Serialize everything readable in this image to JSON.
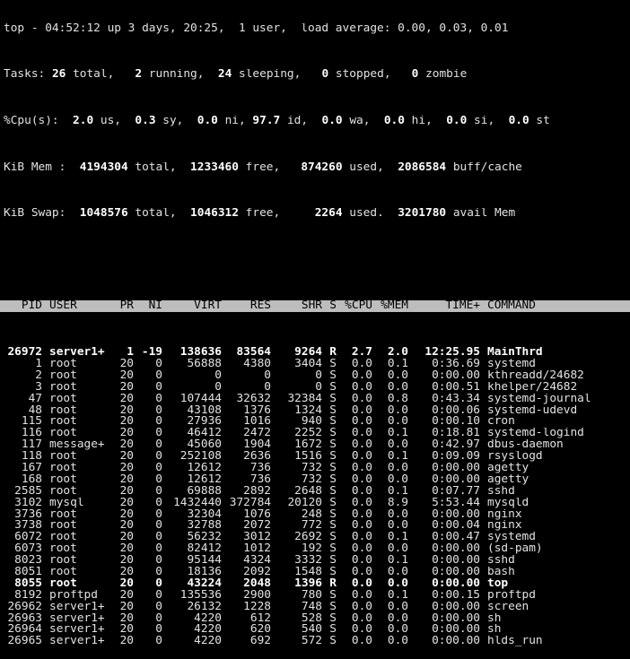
{
  "summary": {
    "top_line": "top - 04:52:12 up 3 days, 20:25,  1 user,  load average: 0.00, 0.03, 0.01",
    "tasks": {
      "label": "Tasks: ",
      "total": "26",
      "total_label": " total,   ",
      "running": "2",
      "running_label": " running,  ",
      "sleeping": "24",
      "sleeping_label": " sleeping,   ",
      "stopped": "0",
      "stopped_label": " stopped,   ",
      "zombie": "0",
      "zombie_label": " zombie"
    },
    "cpu": {
      "label": "%Cpu(s):  ",
      "us": "2.0",
      "us_label": " us,  ",
      "sy": "0.3",
      "sy_label": " sy,  ",
      "ni": "0.0",
      "ni_label": " ni, ",
      "id": "97.7",
      "id_label": " id,  ",
      "wa": "0.0",
      "wa_label": " wa,  ",
      "hi": "0.0",
      "hi_label": " hi,  ",
      "si": "0.0",
      "si_label": " si,  ",
      "st": "0.0",
      "st_label": " st"
    },
    "mem": {
      "label": "KiB Mem :  ",
      "total": "4194304",
      "total_label": " total,  ",
      "free": "1233460",
      "free_label": " free,   ",
      "used": "874260",
      "used_label": " used,  ",
      "buff": "2086584",
      "buff_label": " buff/cache"
    },
    "swap": {
      "label": "KiB Swap:  ",
      "total": "1048576",
      "total_label": " total,  ",
      "free": "1046312",
      "free_label": " free,     ",
      "used": "2264",
      "used_label": " used.  ",
      "avail": "3201780",
      "avail_label": " avail Mem"
    }
  },
  "columns": [
    "PID",
    "USER",
    "PR",
    "NI",
    "VIRT",
    "RES",
    "SHR",
    "S",
    "%CPU",
    "%MEM",
    "TIME+",
    "COMMAND"
  ],
  "processes": [
    {
      "pid": "26972",
      "user": "server1+",
      "pr": "1",
      "ni": "-19",
      "virt": "138636",
      "res": "83564",
      "shr": "9264",
      "s": "R",
      "cpu": "2.7",
      "mem": "2.0",
      "time": "12:25.95",
      "command": "MainThrd",
      "bold": true
    },
    {
      "pid": "1",
      "user": "root",
      "pr": "20",
      "ni": "0",
      "virt": "56888",
      "res": "4380",
      "shr": "3404",
      "s": "S",
      "cpu": "0.0",
      "mem": "0.1",
      "time": "0:36.69",
      "command": "systemd"
    },
    {
      "pid": "2",
      "user": "root",
      "pr": "20",
      "ni": "0",
      "virt": "0",
      "res": "0",
      "shr": "0",
      "s": "S",
      "cpu": "0.0",
      "mem": "0.0",
      "time": "0:00.00",
      "command": "kthreadd/24682"
    },
    {
      "pid": "3",
      "user": "root",
      "pr": "20",
      "ni": "0",
      "virt": "0",
      "res": "0",
      "shr": "0",
      "s": "S",
      "cpu": "0.0",
      "mem": "0.0",
      "time": "0:00.51",
      "command": "khelper/24682"
    },
    {
      "pid": "47",
      "user": "root",
      "pr": "20",
      "ni": "0",
      "virt": "107444",
      "res": "32632",
      "shr": "32384",
      "s": "S",
      "cpu": "0.0",
      "mem": "0.8",
      "time": "0:43.34",
      "command": "systemd-journal"
    },
    {
      "pid": "48",
      "user": "root",
      "pr": "20",
      "ni": "0",
      "virt": "43108",
      "res": "1376",
      "shr": "1324",
      "s": "S",
      "cpu": "0.0",
      "mem": "0.0",
      "time": "0:00.06",
      "command": "systemd-udevd"
    },
    {
      "pid": "115",
      "user": "root",
      "pr": "20",
      "ni": "0",
      "virt": "27936",
      "res": "1016",
      "shr": "940",
      "s": "S",
      "cpu": "0.0",
      "mem": "0.0",
      "time": "0:00.10",
      "command": "cron"
    },
    {
      "pid": "116",
      "user": "root",
      "pr": "20",
      "ni": "0",
      "virt": "46412",
      "res": "2472",
      "shr": "2252",
      "s": "S",
      "cpu": "0.0",
      "mem": "0.1",
      "time": "0:18.81",
      "command": "systemd-logind"
    },
    {
      "pid": "117",
      "user": "message+",
      "pr": "20",
      "ni": "0",
      "virt": "45060",
      "res": "1904",
      "shr": "1672",
      "s": "S",
      "cpu": "0.0",
      "mem": "0.0",
      "time": "0:42.97",
      "command": "dbus-daemon"
    },
    {
      "pid": "118",
      "user": "root",
      "pr": "20",
      "ni": "0",
      "virt": "252108",
      "res": "2636",
      "shr": "1516",
      "s": "S",
      "cpu": "0.0",
      "mem": "0.1",
      "time": "0:09.09",
      "command": "rsyslogd"
    },
    {
      "pid": "167",
      "user": "root",
      "pr": "20",
      "ni": "0",
      "virt": "12612",
      "res": "736",
      "shr": "732",
      "s": "S",
      "cpu": "0.0",
      "mem": "0.0",
      "time": "0:00.00",
      "command": "agetty"
    },
    {
      "pid": "168",
      "user": "root",
      "pr": "20",
      "ni": "0",
      "virt": "12612",
      "res": "736",
      "shr": "732",
      "s": "S",
      "cpu": "0.0",
      "mem": "0.0",
      "time": "0:00.00",
      "command": "agetty"
    },
    {
      "pid": "2585",
      "user": "root",
      "pr": "20",
      "ni": "0",
      "virt": "69888",
      "res": "2892",
      "shr": "2648",
      "s": "S",
      "cpu": "0.0",
      "mem": "0.1",
      "time": "0:07.77",
      "command": "sshd"
    },
    {
      "pid": "3102",
      "user": "mysql",
      "pr": "20",
      "ni": "0",
      "virt": "1432440",
      "res": "372784",
      "shr": "20120",
      "s": "S",
      "cpu": "0.0",
      "mem": "8.9",
      "time": "5:53.44",
      "command": "mysqld"
    },
    {
      "pid": "3736",
      "user": "root",
      "pr": "20",
      "ni": "0",
      "virt": "32304",
      "res": "1076",
      "shr": "248",
      "s": "S",
      "cpu": "0.0",
      "mem": "0.0",
      "time": "0:00.00",
      "command": "nginx"
    },
    {
      "pid": "3738",
      "user": "root",
      "pr": "20",
      "ni": "0",
      "virt": "32788",
      "res": "2072",
      "shr": "772",
      "s": "S",
      "cpu": "0.0",
      "mem": "0.0",
      "time": "0:00.04",
      "command": "nginx"
    },
    {
      "pid": "6072",
      "user": "root",
      "pr": "20",
      "ni": "0",
      "virt": "56232",
      "res": "3012",
      "shr": "2692",
      "s": "S",
      "cpu": "0.0",
      "mem": "0.1",
      "time": "0:00.47",
      "command": "systemd"
    },
    {
      "pid": "6073",
      "user": "root",
      "pr": "20",
      "ni": "0",
      "virt": "82412",
      "res": "1012",
      "shr": "192",
      "s": "S",
      "cpu": "0.0",
      "mem": "0.0",
      "time": "0:00.00",
      "command": "(sd-pam)"
    },
    {
      "pid": "8023",
      "user": "root",
      "pr": "20",
      "ni": "0",
      "virt": "95144",
      "res": "4324",
      "shr": "3332",
      "s": "S",
      "cpu": "0.0",
      "mem": "0.1",
      "time": "0:00.00",
      "command": "sshd"
    },
    {
      "pid": "8051",
      "user": "root",
      "pr": "20",
      "ni": "0",
      "virt": "18136",
      "res": "2092",
      "shr": "1548",
      "s": "S",
      "cpu": "0.0",
      "mem": "0.0",
      "time": "0:00.00",
      "command": "bash"
    },
    {
      "pid": "8055",
      "user": "root",
      "pr": "20",
      "ni": "0",
      "virt": "43224",
      "res": "2048",
      "shr": "1396",
      "s": "R",
      "cpu": "0.0",
      "mem": "0.0",
      "time": "0:00.00",
      "command": "top",
      "bold": true
    },
    {
      "pid": "8192",
      "user": "proftpd",
      "pr": "20",
      "ni": "0",
      "virt": "135536",
      "res": "2900",
      "shr": "780",
      "s": "S",
      "cpu": "0.0",
      "mem": "0.1",
      "time": "0:00.15",
      "command": "proftpd"
    },
    {
      "pid": "26962",
      "user": "server1+",
      "pr": "20",
      "ni": "0",
      "virt": "26132",
      "res": "1228",
      "shr": "748",
      "s": "S",
      "cpu": "0.0",
      "mem": "0.0",
      "time": "0:00.00",
      "command": "screen"
    },
    {
      "pid": "26963",
      "user": "server1+",
      "pr": "20",
      "ni": "0",
      "virt": "4220",
      "res": "612",
      "shr": "528",
      "s": "S",
      "cpu": "0.0",
      "mem": "0.0",
      "time": "0:00.00",
      "command": "sh"
    },
    {
      "pid": "26964",
      "user": "server1+",
      "pr": "20",
      "ni": "0",
      "virt": "4220",
      "res": "620",
      "shr": "540",
      "s": "S",
      "cpu": "0.0",
      "mem": "0.0",
      "time": "0:00.00",
      "command": "sh"
    },
    {
      "pid": "26965",
      "user": "server1+",
      "pr": "20",
      "ni": "0",
      "virt": "4220",
      "res": "692",
      "shr": "572",
      "s": "S",
      "cpu": "0.0",
      "mem": "0.0",
      "time": "0:00.00",
      "command": "hlds_run"
    }
  ]
}
